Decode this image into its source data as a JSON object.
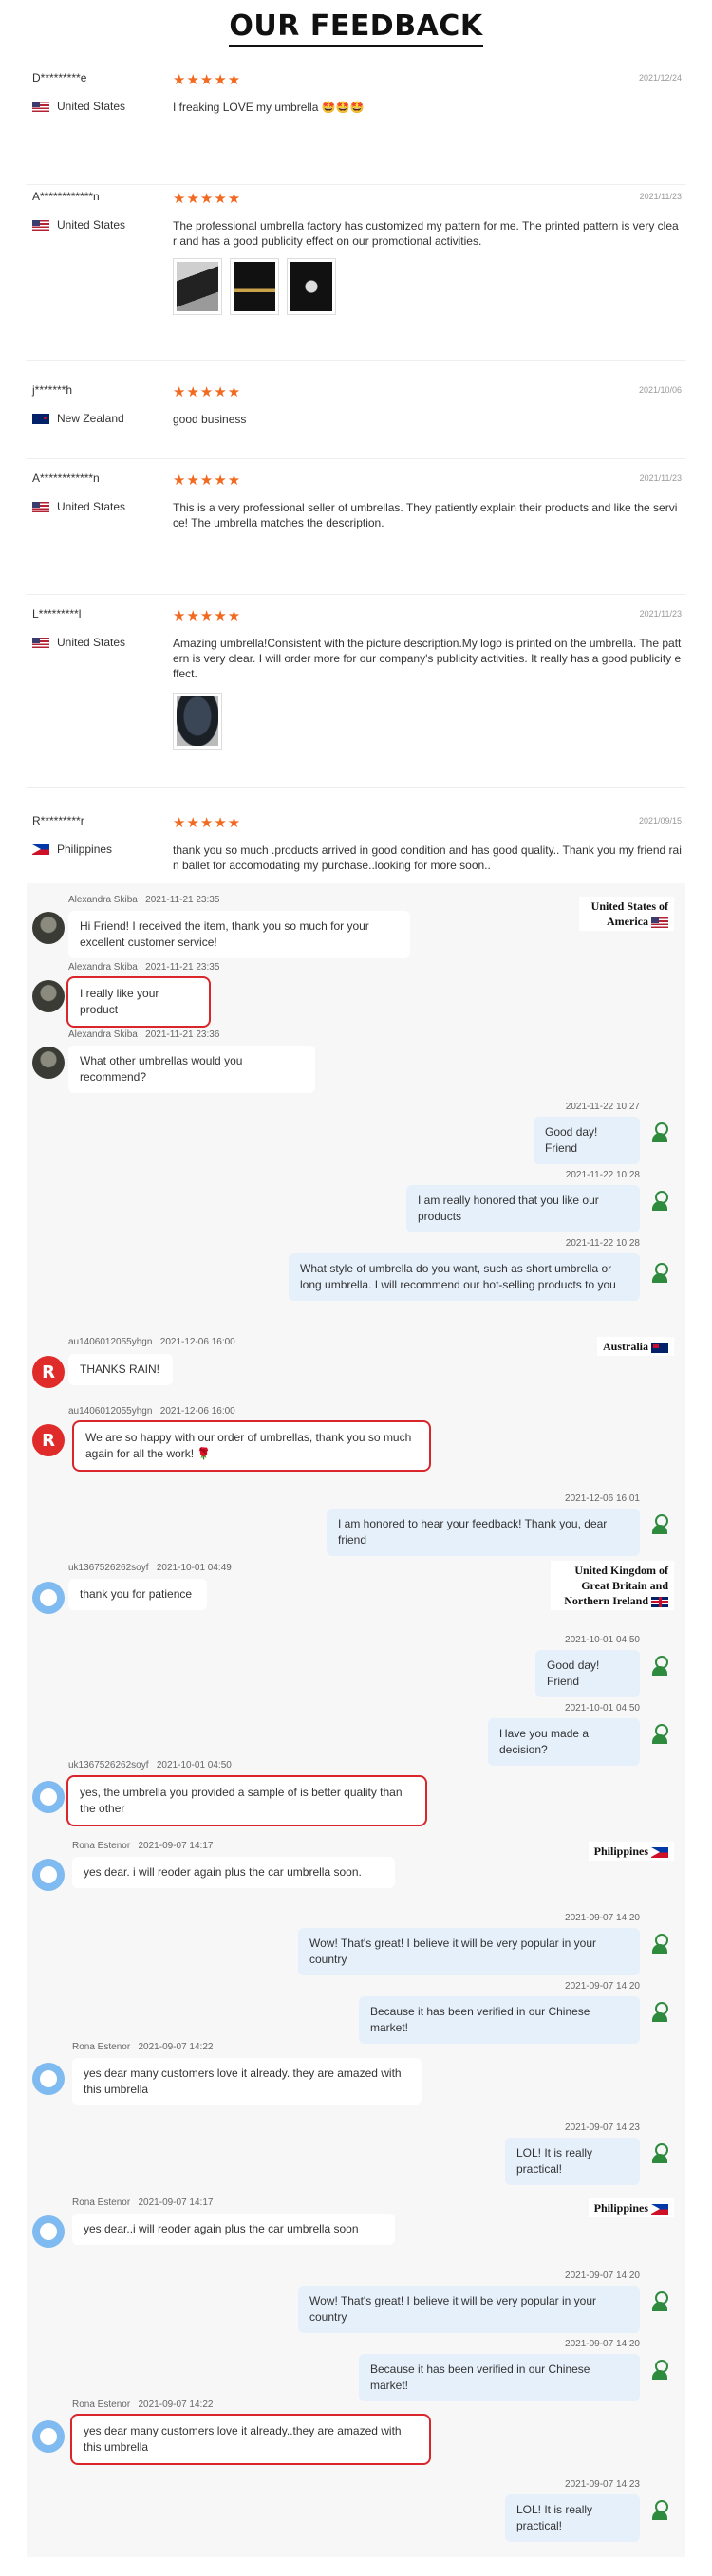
{
  "title": "OUR FEEDBACK",
  "stars": "★★★★★",
  "reviews": [
    {
      "name": "D*********e",
      "country": "United States",
      "date": "2021/12/24",
      "text": "I freaking LOVE my umbrella 🤩🤩🤩"
    },
    {
      "name": "A************n",
      "country": "United States",
      "date": "2021/11/23",
      "text": "The professional umbrella factory has customized my pattern for me. The printed pattern is very clear and has a good publicity effect on our promotional activities."
    },
    {
      "name": "j*******h",
      "country": "New Zealand",
      "date": "2021/10/06",
      "text": "good business"
    },
    {
      "name": "A************n",
      "country": "United States",
      "date": "2021/11/23",
      "text": "This is a very professional seller of umbrellas. They patiently explain their products and like the service! The umbrella matches the description."
    },
    {
      "name": "L*********l",
      "country": "United States",
      "date": "2021/11/23",
      "text": "Amazing umbrella!Consistent with the picture description.My logo is printed on the umbrella. The pattern is very clear. I will order more for our company's publicity activities. It really has a good publicity effect."
    },
    {
      "name": "R*********r",
      "country": "Philippines",
      "date": "2021/09/15",
      "text": "thank you so much .products arrived in good condition and has good quality.. Thank you my friend rain ballet for accomodating my purchase..looking for more soon.."
    }
  ],
  "countries": {
    "usa": "United States of America",
    "australia": "Australia",
    "uk": "United Kingdom of Great Britain and Northern Ireland",
    "ph1": "Philippines",
    "ph2": "Philippines"
  },
  "messages": [
    {
      "sender": "Alexandra Skiba",
      "time": "2021-11-21 23:35",
      "text": "Hi Friend! I received the item, thank you so much for your excellent customer service!"
    },
    {
      "sender": "Alexandra Skiba",
      "time": "2021-11-21 23:35",
      "text": "I really like your product"
    },
    {
      "sender": "Alexandra Skiba",
      "time": "2021-11-21 23:36",
      "text": "What other umbrellas would you recommend?"
    },
    {
      "time": "2021-11-22 10:27",
      "text": "Good day!  Friend"
    },
    {
      "time": "2021-11-22 10:28",
      "text": "I am really honored that you like our products"
    },
    {
      "time": "2021-11-22 10:28",
      "text": "What style of umbrella do you want, such as short umbrella or long umbrella. I will recommend our hot-selling products to you"
    },
    {
      "sender": "au1406012055yhgn",
      "time": "2021-12-06 16:00",
      "text": "THANKS RAIN!"
    },
    {
      "sender": "au1406012055yhgn",
      "time": "2021-12-06 16:00",
      "text": "We are so happy with our order of umbrellas, thank you so much again for all the work! 🌹"
    },
    {
      "time": "2021-12-06 16:01",
      "text": "I am honored to hear your feedback! Thank you, dear friend"
    },
    {
      "sender": "uk1367526262soyf",
      "time": "2021-10-01 04:49",
      "text": "thank you for patience"
    },
    {
      "time": "2021-10-01 04:50",
      "text": "Good day! Friend"
    },
    {
      "time": "2021-10-01 04:50",
      "text": "Have you made a decision?"
    },
    {
      "sender": "uk1367526262soyf",
      "time": "2021-10-01 04:50",
      "text": "yes, the umbrella you provided a sample of is better quality than the other"
    },
    {
      "sender": "Rona Estenor",
      "time": "2021-09-07 14:17",
      "text": "yes dear. i will reoder again plus the car umbrella soon."
    },
    {
      "time": "2021-09-07 14:20",
      "text": "Wow! That's great! I believe it will be very popular in your country"
    },
    {
      "time": "2021-09-07 14:20",
      "text": "Because it has been verified in our Chinese market!"
    },
    {
      "sender": "Rona Estenor",
      "time": "2021-09-07 14:22",
      "text": "yes dear many customers love it already. they are amazed with this umbrella"
    },
    {
      "time": "2021-09-07 14:23",
      "text": "LOL! It is really practical!"
    },
    {
      "sender": "Rona Estenor",
      "time": "2021-09-07 14:17",
      "text": "yes dear..i will reoder again plus the car umbrella soon"
    },
    {
      "time": "2021-09-07 14:20",
      "text": "Wow! That's great! I believe it will be very popular in your country"
    },
    {
      "time": "2021-09-07 14:20",
      "text": "Because it has been verified in our Chinese market!"
    },
    {
      "sender": "Rona Estenor",
      "time": "2021-09-07 14:22",
      "text": "yes dear many customers love it already..they are amazed with this umbrella"
    },
    {
      "time": "2021-09-07 14:23",
      "text": "LOL! It is really practical!"
    }
  ]
}
